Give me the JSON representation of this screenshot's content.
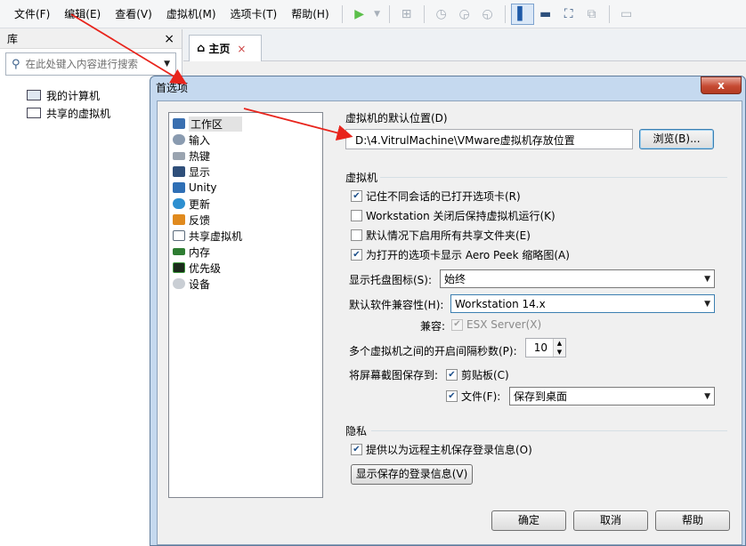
{
  "menubar": {
    "items": [
      "文件(F)",
      "编辑(E)",
      "查看(V)",
      "虚拟机(M)",
      "选项卡(T)",
      "帮助(H)"
    ]
  },
  "library": {
    "title": "库",
    "close": "×",
    "search_placeholder": "在此处键入内容进行搜索",
    "tree": [
      "我的计算机",
      "共享的虚拟机"
    ]
  },
  "tabs": {
    "home_label": "主页",
    "home_close": "×"
  },
  "dialog": {
    "title": "首选项",
    "close": "x",
    "nav": [
      {
        "label": "工作区",
        "icon": "workspace-icon",
        "color": "#3a6fb0"
      },
      {
        "label": "输入",
        "icon": "mouse-icon",
        "color": "#8a9bb0"
      },
      {
        "label": "热键",
        "icon": "keyboard-icon",
        "color": "#9aa4b0"
      },
      {
        "label": "显示",
        "icon": "monitor-icon",
        "color": "#2f4f7a"
      },
      {
        "label": "Unity",
        "icon": "unity-icon",
        "color": "#2f6fb5"
      },
      {
        "label": "更新",
        "icon": "update-icon",
        "color": "#2d8fd0"
      },
      {
        "label": "反馈",
        "icon": "feedback-icon",
        "color": "#e08a1e"
      },
      {
        "label": "共享虚拟机",
        "icon": "shared-vm-icon",
        "color": "#5a6a7a"
      },
      {
        "label": "内存",
        "icon": "memory-icon",
        "color": "#2e7d32"
      },
      {
        "label": "优先级",
        "icon": "priority-icon",
        "color": "#3d9a3d"
      },
      {
        "label": "设备",
        "icon": "device-icon",
        "color": "#9aa0a8"
      }
    ],
    "default_location": {
      "label": "虚拟机的默认位置(D)",
      "path": "D:\\4.VitrulMachine\\VMware虚拟机存放位置",
      "browse": "浏览(B)..."
    },
    "vm_group": {
      "label": "虚拟机",
      "checks": [
        {
          "label": "记住不同会话的已打开选项卡(R)",
          "checked": true
        },
        {
          "label": "Workstation 关闭后保持虚拟机运行(K)",
          "checked": false
        },
        {
          "label": "默认情况下启用所有共享文件夹(E)",
          "checked": false
        },
        {
          "label": "为打开的选项卡显示 Aero Peek 缩略图(A)",
          "checked": true
        }
      ],
      "tray_label": "显示托盘图标(S):",
      "tray_value": "始终",
      "compat_label": "默认软件兼容性(H):",
      "compat_value": "Workstation 14.x",
      "compatible_label": "兼容:",
      "esx_label": "ESX Server(X)",
      "interval_label": "多个虚拟机之间的开启间隔秒数(P):",
      "interval_value": "10",
      "screenshot_label": "将屏幕截图保存到:",
      "clipboard_label": "剪贴板(C)",
      "file_label": "文件(F):",
      "file_value": "保存到桌面"
    },
    "privacy": {
      "label": "隐私",
      "check_label": "提供以为远程主机保存登录信息(O)",
      "show_button": "显示保存的登录信息(V)"
    },
    "buttons": {
      "ok": "确定",
      "cancel": "取消",
      "help": "帮助"
    }
  },
  "colors": {
    "annotation_arrow": "#e8241c",
    "dialog_frame": "#c5d9ef",
    "close_button": "#c64a32"
  }
}
